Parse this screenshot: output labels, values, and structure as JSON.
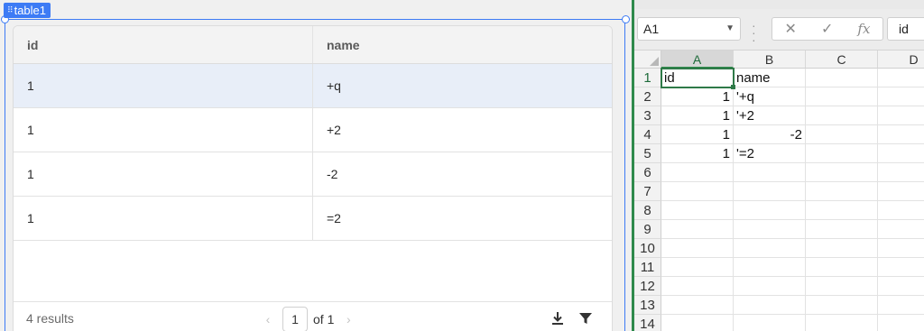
{
  "component_tag": "table1",
  "table": {
    "columns": [
      "id",
      "name"
    ],
    "rows": [
      {
        "id": "1",
        "name": "+q"
      },
      {
        "id": "1",
        "name": "+2"
      },
      {
        "id": "1",
        "name": "-2"
      },
      {
        "id": "1",
        "name": "=2"
      }
    ],
    "results_label": "4 results",
    "page_current": "1",
    "page_of": "of 1"
  },
  "spreadsheet": {
    "name_box": "A1",
    "formula_value": "id",
    "fx_label": "fx",
    "column_headers": [
      "A",
      "B",
      "C",
      "D"
    ],
    "row_headers": [
      "1",
      "2",
      "3",
      "4",
      "5",
      "6",
      "7",
      "8",
      "9",
      "10",
      "11",
      "12",
      "13",
      "14"
    ],
    "cells": [
      {
        "ref": "A1",
        "value": "id",
        "align": "left"
      },
      {
        "ref": "B1",
        "value": "name",
        "align": "left"
      },
      {
        "ref": "A2",
        "value": "1",
        "align": "right"
      },
      {
        "ref": "B2",
        "value": "'+q",
        "align": "left"
      },
      {
        "ref": "A3",
        "value": "1",
        "align": "right"
      },
      {
        "ref": "B3",
        "value": "'+2",
        "align": "left"
      },
      {
        "ref": "A4",
        "value": "1",
        "align": "right"
      },
      {
        "ref": "B4",
        "value": "-2",
        "align": "right"
      },
      {
        "ref": "A5",
        "value": "1",
        "align": "right"
      },
      {
        "ref": "B5",
        "value": "'=2",
        "align": "left"
      }
    ],
    "active_cell": "A1"
  },
  "colors": {
    "selection": "#3d7bf5",
    "excel_green": "#2f8a4c",
    "selected_row": "#e8eef8"
  }
}
